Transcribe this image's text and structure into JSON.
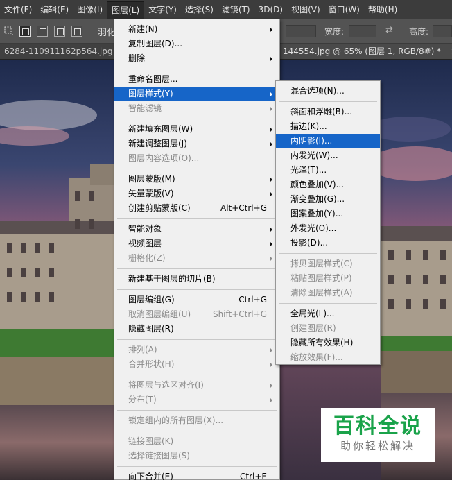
{
  "menubar": {
    "items": [
      "文件(F)",
      "编辑(E)",
      "图像(I)",
      "图层(L)",
      "文字(Y)",
      "选择(S)",
      "滤镜(T)",
      "3D(D)",
      "视图(V)",
      "窗口(W)",
      "帮助(H)"
    ],
    "active_index": 3
  },
  "options": {
    "feather_label": "羽化",
    "width_label": "宽度:",
    "height_label": "高度:"
  },
  "tabs": {
    "left_tab": "6284-110911162p564.jpg @ 66% (图层",
    "right_tab": "144554.jpg @ 65% (图层 1, RGB/8#) *",
    "close_glyph": "×"
  },
  "layer_menu": {
    "groups": [
      [
        {
          "label": "新建(N)",
          "submenu": true
        },
        {
          "label": "复制图层(D)..."
        },
        {
          "label": "删除",
          "submenu": true
        }
      ],
      [
        {
          "label": "重命名图层..."
        },
        {
          "label": "图层样式(Y)",
          "submenu": true,
          "highlighted": true
        },
        {
          "label": "智能滤镜",
          "submenu": true,
          "disabled": true
        }
      ],
      [
        {
          "label": "新建填充图层(W)",
          "submenu": true
        },
        {
          "label": "新建调整图层(J)",
          "submenu": true
        },
        {
          "label": "图层内容选项(O)...",
          "disabled": true
        }
      ],
      [
        {
          "label": "图层蒙版(M)",
          "submenu": true
        },
        {
          "label": "矢量蒙版(V)",
          "submenu": true
        },
        {
          "label": "创建剪贴蒙版(C)",
          "shortcut": "Alt+Ctrl+G"
        }
      ],
      [
        {
          "label": "智能对象",
          "submenu": true
        },
        {
          "label": "视频图层",
          "submenu": true
        },
        {
          "label": "栅格化(Z)",
          "submenu": true,
          "disabled": true
        }
      ],
      [
        {
          "label": "新建基于图层的切片(B)"
        }
      ],
      [
        {
          "label": "图层编组(G)",
          "shortcut": "Ctrl+G"
        },
        {
          "label": "取消图层编组(U)",
          "shortcut": "Shift+Ctrl+G",
          "disabled": true
        },
        {
          "label": "隐藏图层(R)"
        }
      ],
      [
        {
          "label": "排列(A)",
          "submenu": true,
          "disabled": true
        },
        {
          "label": "合并形状(H)",
          "submenu": true,
          "disabled": true
        }
      ],
      [
        {
          "label": "将图层与选区对齐(I)",
          "submenu": true,
          "disabled": true
        },
        {
          "label": "分布(T)",
          "submenu": true,
          "disabled": true
        }
      ],
      [
        {
          "label": "锁定组内的所有图层(X)...",
          "disabled": true
        }
      ],
      [
        {
          "label": "链接图层(K)",
          "disabled": true
        },
        {
          "label": "选择链接图层(S)",
          "disabled": true
        }
      ],
      [
        {
          "label": "向下合并(E)",
          "shortcut": "Ctrl+E"
        }
      ]
    ]
  },
  "style_menu": {
    "groups": [
      [
        {
          "label": "混合选项(N)..."
        }
      ],
      [
        {
          "label": "斜面和浮雕(B)..."
        },
        {
          "label": "描边(K)..."
        },
        {
          "label": "内阴影(I)...",
          "highlighted": true
        },
        {
          "label": "内发光(W)..."
        },
        {
          "label": "光泽(T)..."
        },
        {
          "label": "颜色叠加(V)..."
        },
        {
          "label": "渐变叠加(G)..."
        },
        {
          "label": "图案叠加(Y)..."
        },
        {
          "label": "外发光(O)..."
        },
        {
          "label": "投影(D)..."
        }
      ],
      [
        {
          "label": "拷贝图层样式(C)",
          "disabled": true
        },
        {
          "label": "粘贴图层样式(P)",
          "disabled": true
        },
        {
          "label": "清除图层样式(A)",
          "disabled": true
        }
      ],
      [
        {
          "label": "全局光(L)..."
        },
        {
          "label": "创建图层(R)",
          "disabled": true
        },
        {
          "label": "隐藏所有效果(H)"
        },
        {
          "label": "缩放效果(F)...",
          "disabled": true
        }
      ]
    ]
  },
  "watermark": {
    "title": "百科全说",
    "subtitle": "助你轻松解决"
  },
  "colors": {
    "menu_highlight": "#1665c8",
    "watermark_green": "#1aa34a"
  }
}
